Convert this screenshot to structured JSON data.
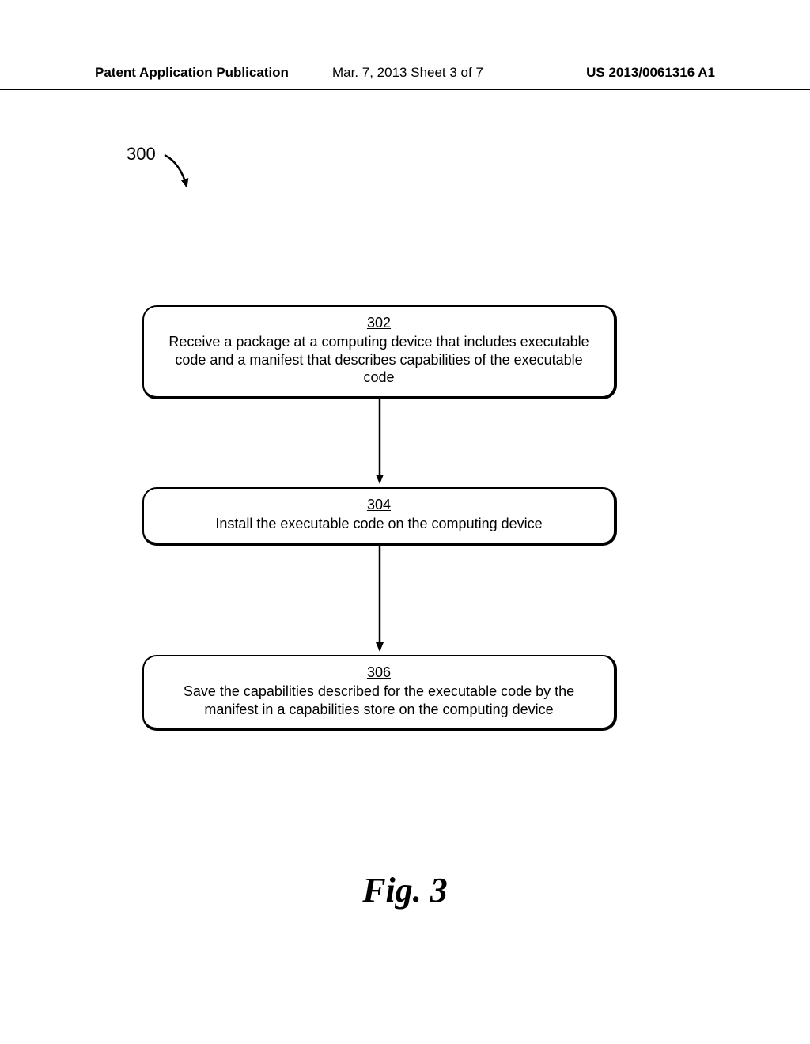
{
  "header": {
    "left": "Patent Application Publication",
    "mid": "Mar. 7, 2013  Sheet 3 of 7",
    "right": "US 2013/0061316 A1"
  },
  "reference_number": "300",
  "steps": [
    {
      "num": "302",
      "text": "Receive a package at a computing device that includes executable code and a manifest that describes capabilities of the executable code"
    },
    {
      "num": "304",
      "text": "Install the executable code on the computing device"
    },
    {
      "num": "306",
      "text": "Save the capabilities described for the executable code by the manifest in a capabilities store on the computing device"
    }
  ],
  "figure_label": "Fig. 3"
}
